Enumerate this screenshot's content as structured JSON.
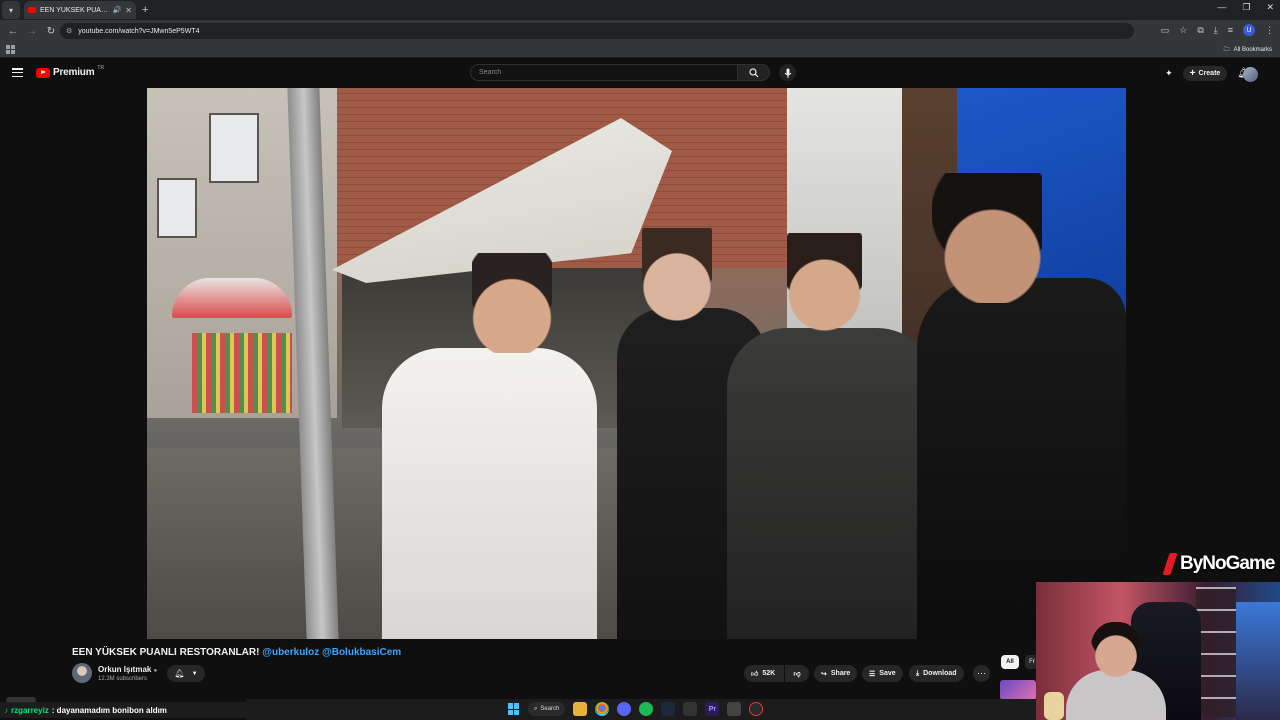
{
  "browser": {
    "tab_title": "EEN YÜKSEK PUANLI RESTO",
    "url": "youtube.com/watch?v=JMwn5eP5WT4",
    "bookmarks_label": "All Bookmarks",
    "profile_initial": "U"
  },
  "youtube": {
    "logo_text": "Premium",
    "logo_region": "TR",
    "search_placeholder": "Search",
    "create_label": "Create"
  },
  "video": {
    "title_main": "EEN YÜKSEK PUANLI RESTORANLAR!",
    "title_tags": "@uberkuloz @BolukbasiCem",
    "channel_name": "Orkun Işıtmak",
    "subscribers": "12.3M subscribers",
    "likes": "52K",
    "share_label": "Share",
    "save_label": "Save",
    "download_label": "Download"
  },
  "sidebar_chips": {
    "all": "All",
    "second": "Fr"
  },
  "overlay": {
    "brand": "ByNoGame",
    "chat_user": "rzgarreyiz",
    "chat_message": ": dayanamadım bonibon aldım"
  },
  "taskbar": {
    "search_label": "Search"
  },
  "colors": {
    "youtube_red": "#ff0000",
    "link_blue": "#3ea6ff",
    "chat_green": "#00e676",
    "brand_red": "#e31b23"
  }
}
